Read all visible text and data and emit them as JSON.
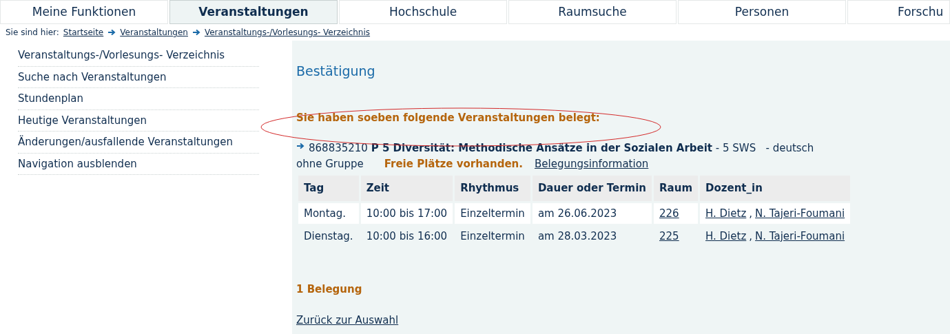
{
  "tabs": [
    {
      "label": "Meine Funktionen",
      "selected": false
    },
    {
      "label": "Veranstaltungen",
      "selected": true
    },
    {
      "label": "Hochschule",
      "selected": false
    },
    {
      "label": "Raumsuche",
      "selected": false
    },
    {
      "label": "Personen",
      "selected": false
    },
    {
      "label": "Forschu",
      "selected": false
    }
  ],
  "breadcrumb": {
    "prefix": "Sie sind hier:",
    "items": [
      "Startseite",
      "Veranstaltungen",
      "Veranstaltungs-/Vorlesungs- Verzeichnis"
    ]
  },
  "sidebar": {
    "items": [
      "Veranstaltungs-/Vorlesungs- Verzeichnis",
      "Suche nach Veranstaltungen",
      "Stundenplan",
      "Heutige Veranstaltungen",
      "Änderungen/ausfallende Veranstaltungen",
      "Navigation ausblenden"
    ]
  },
  "content": {
    "heading": "Bestätigung",
    "notice": "Sie haben soeben folgende Veranstaltungen belegt:",
    "course": {
      "line": "868835210 **P 5 Diversität: Methodische Ansätze in der Sozialen Arbeit** - 5 SWS   - deutsch",
      "group": "ohne Gruppe",
      "availability": "Freie Plätze vorhanden.",
      "info_link": "Belegungsinformation"
    },
    "table": {
      "columns": [
        "Tag",
        "Zeit",
        "Rhythmus",
        "Dauer oder Termin",
        "Raum",
        "Dozent_in"
      ],
      "lecturer_separator": ",",
      "rows": [
        {
          "day": "Montag.",
          "time": "10:00 bis 17:00",
          "rhythm": "Einzeltermin",
          "date": "am 26.06.2023",
          "room": "226",
          "lecturers": [
            "H. Dietz",
            "N. Tajeri-Foumani"
          ]
        },
        {
          "day": "Dienstag.",
          "time": "10:00 bis 16:00",
          "rhythm": "Einzeltermin",
          "date": "am 28.03.2023",
          "room": "225",
          "lecturers": [
            "H. Dietz",
            "N. Tajeri-Foumani"
          ]
        }
      ]
    },
    "count": "1 Belegung",
    "back_link": "Zurück zur Auswahl"
  }
}
